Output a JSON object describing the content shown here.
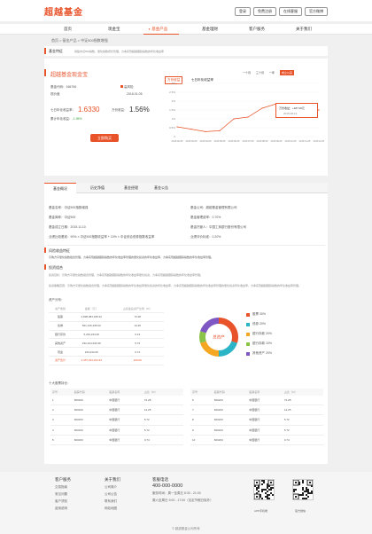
{
  "header": {
    "logo": "超越基金",
    "links": [
      "登录",
      "免费注册",
      "在线客服",
      "官方微博"
    ]
  },
  "nav": {
    "items": [
      "首页",
      "现金宝",
      "基金产品",
      "基金理财",
      "客户服务",
      "关于我们"
    ],
    "active_marker": "▼"
  },
  "breadcrumb": "首页 > 基金产品 > 中证500指数增强",
  "feature": {
    "label": "基金特征",
    "text": "用股中证500指数、量化指数增长管理，力争实现超越跟踪指数的年化收益率"
  },
  "fund": {
    "name": "超越基金现金宝",
    "code_label": "基金代码：166706",
    "risk": "高风险",
    "nav_date_label": "现价值",
    "nav_date": "2016.01.05",
    "seven_day_label": "七日年化收益率：",
    "seven_day_value": "1.6330",
    "wan_label": "万份收益：",
    "wan_value": "1.56%",
    "accum_label": "累计年化收益：",
    "accum_value": "-1.95%",
    "buy_button": "立即购买"
  },
  "chart_panel": {
    "tabs": [
      "万份收益",
      "七日年化收益率"
    ],
    "ranges": [
      "一个月",
      "三个月",
      "一年",
      "成立以来"
    ],
    "active_range": "成立以来",
    "tooltip_line1": "万份收益：+187.00元",
    "tooltip_line2": "2015-08-13"
  },
  "chart_data": {
    "type": "line",
    "x": [
      "2015.02.05",
      "2015.03.05",
      "2015.04.05",
      "2015.05.05",
      "2015.06.05",
      "2015.07.05",
      "2015.08.05",
      "2015.09.05",
      "2015.10.05",
      "2015.11.05",
      "2015.12.05"
    ],
    "values": [
      0.55,
      0.42,
      0.28,
      0.33,
      1.0,
      1.1,
      1.6,
      1.85,
      1.7,
      1.55,
      1.5
    ],
    "yticks": [
      "3%",
      "2.5%",
      "2%",
      "1.5%",
      "1%",
      "0.5%",
      "0"
    ],
    "ylim": [
      0,
      3
    ],
    "title": "",
    "xlabel": "",
    "ylabel": ""
  },
  "tabs": [
    "基金概况",
    "历史净值",
    "基金经理",
    "基金公告"
  ],
  "overview": {
    "left": [
      "基金名称：中证500指数增强",
      "基金简称：中证500",
      "基金成立日期：2015.11.10",
      "业绩比较基准：90% × 中证500指数收益率 + 10% × 中证综合债券指数收益率"
    ],
    "right": [
      "基金公司：超越基金管理有限公司",
      "基金管理费率：0.70%",
      "基金托管人：中国工商银行股份有限公司",
      "业绩评价标准：0.20%"
    ]
  },
  "risk_section": {
    "title": "风险收益特征",
    "text": "引购方平量化指数组合管理，力争实现超越跟踪指数的年化收益率管理的量化投资的年化收益率，力争实现超越跟踪指数的年化收益率管理。"
  },
  "investment_section": {
    "title": "投资组合",
    "paragraphs": [
      "投资目标：引购方平量化指数组合管理，力争实现超越跟踪指数的年化收益率量化投资，力争实现超越跟踪指数的年化收益率管理。",
      "投资策略范围：引购方平量化指数组合管理，力争实现超越跟踪指数的年化收益率量化投资的年化收益率，力争实现超越跟踪指数的年化收益率管理的量化投资年化收益率，力争实现超越跟踪指数的年化收益率管理。"
    ],
    "asset_title": "资产分布：",
    "asset_headers": [
      "资产类别",
      "金额（元）",
      "占基金总资产比例（%）"
    ],
    "asset_rows": [
      [
        "股票",
        "2,838,384,345.32",
        "72.28"
      ],
      [
        "债券",
        "561,145,435.00",
        "14.25"
      ],
      [
        "银行存款",
        "5,234,234.00",
        "0.13"
      ],
      [
        "其他资产",
        "232,234,234.99",
        "5.72"
      ],
      [
        "现金",
        "234,234.00",
        "0.74"
      ]
    ],
    "asset_total": [
      "资产合计",
      "4,457,234,234.33",
      "100.00"
    ]
  },
  "donut": {
    "center": "总资产",
    "legend": [
      "股票 30%",
      "债券 20%",
      "银行存款 20%",
      "银行存款 10%",
      "其他资产 20%"
    ],
    "colors": [
      "#e8532a",
      "#2bb3c6",
      "#f5a623",
      "#8bc34a",
      "#7e57c2"
    ]
  },
  "holdings": {
    "title": "十大股票持仓：",
    "headers": [
      "序号",
      "股票代码",
      "股票名称",
      "占比（%）"
    ],
    "left_rows": [
      [
        "1",
        "600233",
        "中国银行",
        "72.28"
      ],
      [
        "2",
        "600233",
        "中国银行",
        "14.25"
      ],
      [
        "3",
        "600233",
        "中国银行",
        "5.72"
      ],
      [
        "4",
        "600233",
        "中国银行",
        "5.72"
      ],
      [
        "5",
        "600233",
        "中国银行",
        "0.74"
      ]
    ],
    "right_rows": [
      [
        "6",
        "600233",
        "中国银行",
        "72.28"
      ],
      [
        "7",
        "600233",
        "中国银行",
        "14.25"
      ],
      [
        "8",
        "600233",
        "中国银行",
        "5.72"
      ],
      [
        "9",
        "600233",
        "中国银行",
        "5.72"
      ],
      [
        "10",
        "600233",
        "中国银行",
        "0.74"
      ]
    ]
  },
  "footer": {
    "col1_title": "客户服务",
    "col1": [
      "交易指南",
      "常见问题",
      "客户须知",
      "费用说明"
    ],
    "col2_title": "关于我们",
    "col2": [
      "公司简介",
      "公司公告",
      "联系我们",
      "网站地图"
    ],
    "hotline_title": "客服电话",
    "hotline": "400-000-0000",
    "hours1": "服务时间：周一至周五 8:30 - 21:00",
    "hours2": "周六至周日 9:00 - 17:00（法定节假日除外）",
    "qr1": "APP手机端",
    "qr2": "官方微信",
    "copyright": "© 超越基金公司所有"
  }
}
